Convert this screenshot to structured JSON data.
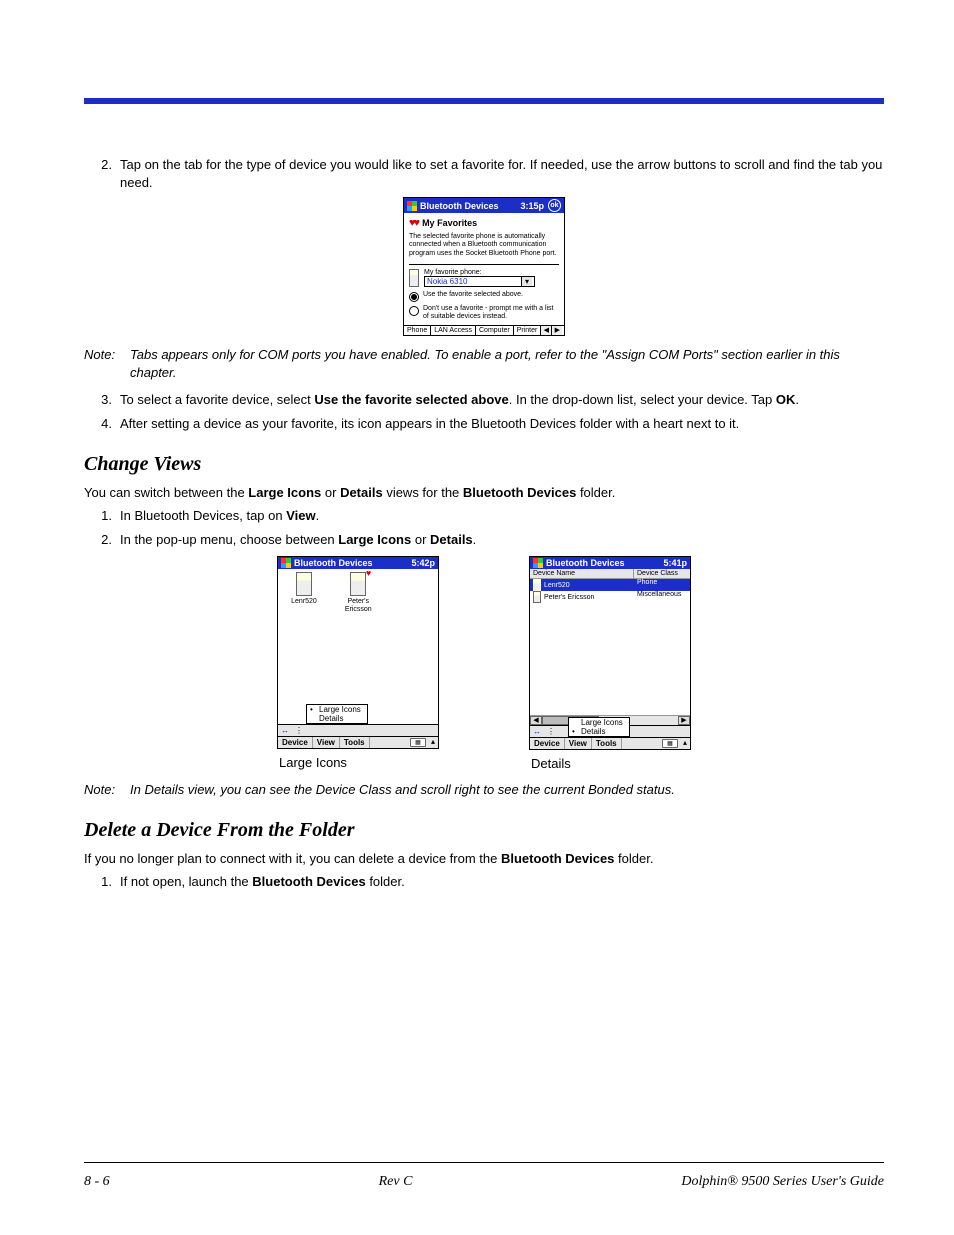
{
  "step2": {
    "num": "2.",
    "text": "Tap on the tab for the type of device you would like to set a favorite for. If needed, use the arrow buttons to scroll and find the tab you need."
  },
  "fig1": {
    "title": "Bluetooth Devices",
    "time": "3:15p",
    "ok": "ok",
    "fav_head": "My Favorites",
    "desc": "The selected favorite phone is automatically connected when a Bluetooth communication program uses the Socket Bluetooth Phone port.",
    "dd_label": "My favorite phone:",
    "dd_val": "Nokia 6310",
    "radio1": "Use the favorite selected above.",
    "radio2": "Don't use a favorite - prompt me with a list of suitable devices instead.",
    "tabs": [
      "Phone",
      "LAN Access",
      "Computer",
      "Printer"
    ],
    "arr_l": "◀",
    "arr_r": "▶",
    "dd_arr": "▾"
  },
  "note1": {
    "label": "Note:",
    "text_a": "Tabs appears only for COM ports you have enabled. To enable a port, refer to the \"Assign COM Ports\" section earlier in this chapter."
  },
  "step3": {
    "num": "3.",
    "pre": "To select a favorite device, select ",
    "b1": "Use the favorite selected above",
    "mid": ". In the drop-down list, select your device. Tap ",
    "b2": "OK",
    "post": "."
  },
  "step4": {
    "num": "4.",
    "text": "After setting a device as your favorite, its icon appears in the Bluetooth Devices folder with a heart next to it."
  },
  "h_change": "Change Views",
  "cv_intro": {
    "pre": "You can switch between the ",
    "b1": "Large Icons",
    "mid1": " or ",
    "b2": "Details",
    "mid2": " views for the ",
    "b3": "Bluetooth Devices",
    "post": " folder."
  },
  "cv1": {
    "num": "1.",
    "pre": "In Bluetooth Devices, tap on ",
    "b": "View",
    "post": "."
  },
  "cv2": {
    "num": "2.",
    "pre": "In the pop-up menu, choose between ",
    "b1": "Large Icons",
    "mid": " or ",
    "b2": "Details",
    "post": "."
  },
  "figL": {
    "title": "Bluetooth Devices",
    "time": "5:42p",
    "dev1": "Lenr520",
    "dev2a": "Peter's",
    "dev2b": "Ericsson",
    "menu1": "Large Icons",
    "menu2": "Details",
    "bot": [
      "Device",
      "View",
      "Tools"
    ],
    "up": "▴",
    "caption": "Large Icons"
  },
  "figR": {
    "title": "Bluetooth Devices",
    "time": "5:41p",
    "col1": "Device Name",
    "col2": "Device Class",
    "r1c1": "Lenr520",
    "r1c2": "Phone",
    "r2c1": "Peter's Ericsson",
    "r2c2": "Miscellaneous",
    "menu1": "Large Icons",
    "menu2": "Details",
    "bot": [
      "Device",
      "View",
      "Tools"
    ],
    "up": "▴",
    "arr_l": "◀",
    "arr_r": "▶",
    "caption": "Details"
  },
  "note2": {
    "label": "Note:",
    "text": "In Details view, you can see the Device Class and scroll right to see the current Bonded status."
  },
  "h_delete": "Delete a Device From the Folder",
  "del_intro": {
    "pre": "If you no longer plan to connect with it, you can delete a device from the ",
    "b": "Bluetooth Devices",
    "post": " folder."
  },
  "del1": {
    "num": "1.",
    "pre": "If not open, launch the ",
    "b": "Bluetooth Devices",
    "post": " folder."
  },
  "footer": {
    "left": "8 - 6",
    "center": "Rev C",
    "right": "Dolphin® 9500 Series User's Guide"
  },
  "hearts": "♥♥"
}
